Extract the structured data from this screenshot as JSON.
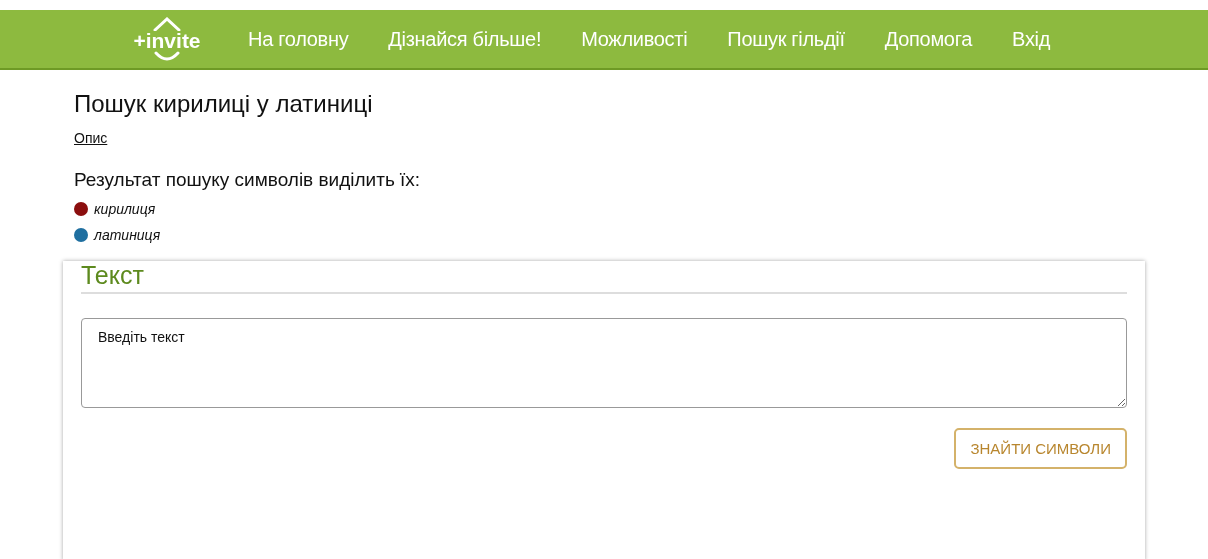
{
  "nav": {
    "logo": "+invite",
    "items": [
      {
        "label": "На головну"
      },
      {
        "label": "Дізнайся більше!"
      },
      {
        "label": "Можливості"
      },
      {
        "label": "Пошук гільдії"
      },
      {
        "label": "Допомога"
      },
      {
        "label": "Вхід"
      }
    ]
  },
  "title": "Пошук кирилиці у латиниці",
  "link": "Опис",
  "legend_title": "Результат пошуку символів виділить їх:",
  "legend": [
    {
      "label": "кирилиця",
      "color": "#8b0e0e"
    },
    {
      "label": "латиниця",
      "color": "#1f6fa0"
    }
  ],
  "card": {
    "heading": "Текст",
    "text_field": {
      "value": "Введіть текст"
    },
    "button": "ЗНАЙТИ СИМВОЛИ"
  }
}
